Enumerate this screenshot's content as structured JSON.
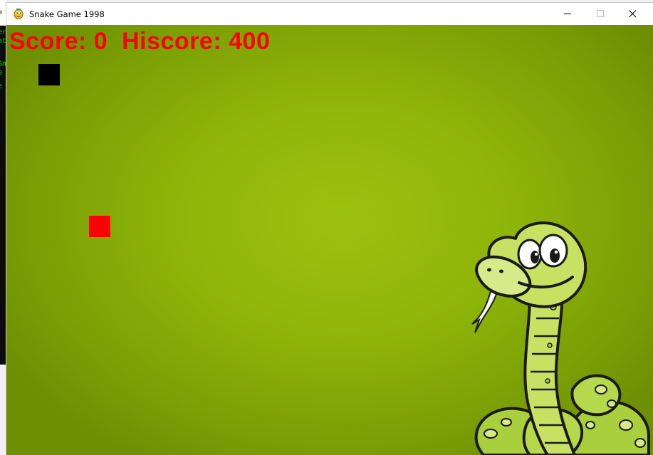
{
  "window": {
    "title": "Snake Game 1998",
    "controls": {
      "minimize": "minimize",
      "maximize": "maximize",
      "close": "close"
    }
  },
  "hud": {
    "score_label": "Score:",
    "score_value": "0",
    "hiscore_label": "Hiscore:",
    "hiscore_value": "400"
  },
  "game": {
    "snake_color": "#000000",
    "food_color": "#ff0000",
    "background_color": "#8db409",
    "text_color": "#ff0000",
    "mascot": "cartoon-snake"
  },
  "background_terminal": {
    "lines": [
      "m",
      "er",
      "at",
      "",
      "",
      "",
      "Ga",
      "0",
      "e"
    ]
  }
}
